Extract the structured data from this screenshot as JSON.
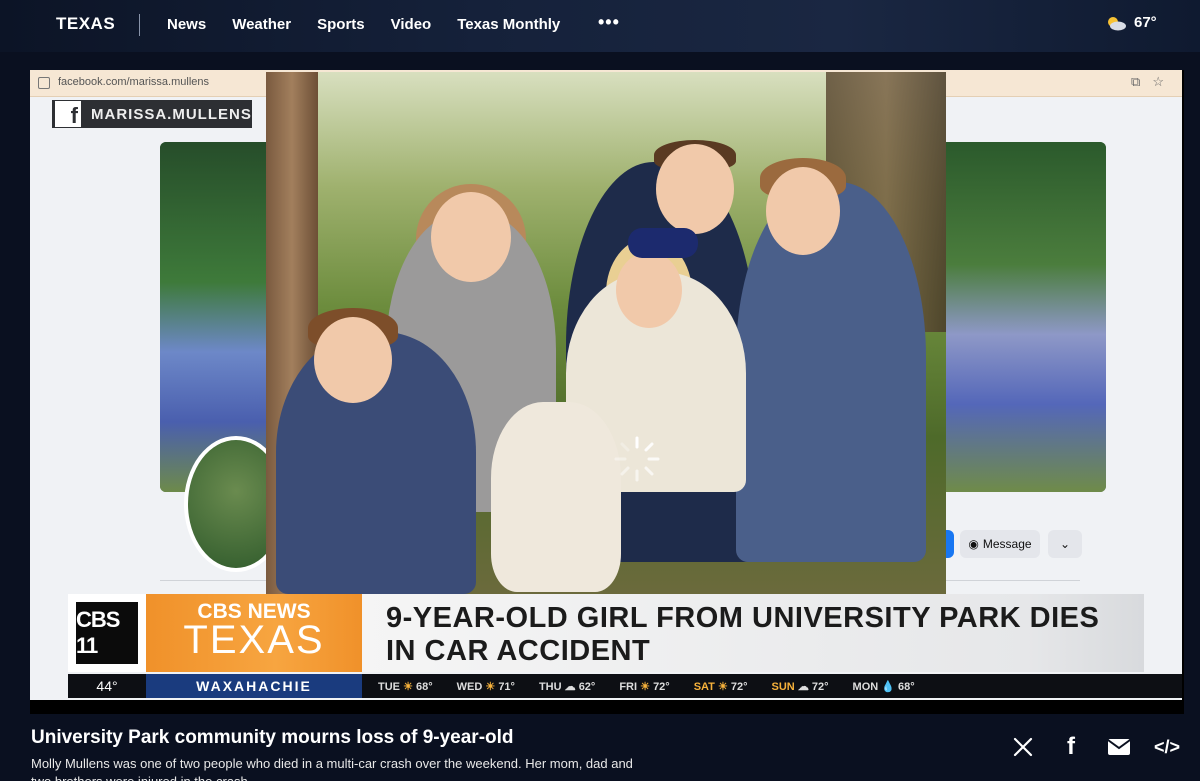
{
  "nav": {
    "brand": "TEXAS",
    "items": [
      "News",
      "Weather",
      "Sports",
      "Video",
      "Texas Monthly"
    ],
    "more": "•••",
    "weather_temp": "67°"
  },
  "player": {
    "browser_url": "facebook.com/marissa.mullens",
    "fb_tag": "MARISSA.MULLENS",
    "fb_message_button": "Message",
    "lower_third": {
      "station_logo": "CBS 11",
      "network_line1": "CBS NEWS",
      "network_line2": "TEXAS",
      "headline": "9-YEAR-OLD GIRL FROM UNIVERSITY PARK DIES IN CAR ACCIDENT"
    },
    "ticker": {
      "temp": "44°",
      "city": "WAXAHACHIE",
      "forecast": [
        {
          "day": "TUE",
          "temp": "68°"
        },
        {
          "day": "WED",
          "temp": "71°"
        },
        {
          "day": "THU",
          "temp": "62°"
        },
        {
          "day": "FRI",
          "temp": "72°"
        },
        {
          "day": "SAT",
          "temp": "72°"
        },
        {
          "day": "SUN",
          "temp": "72°"
        },
        {
          "day": "MON",
          "temp": "68°"
        }
      ]
    }
  },
  "article": {
    "title": "University Park community mourns loss of 9-year-old",
    "summary": "Molly Mullens was one of two people who died in a multi-car crash over the weekend. Her mom, dad and two brothers were injured in the crash."
  },
  "share": {
    "icons": [
      "x-icon",
      "facebook-icon",
      "email-icon",
      "embed-icon"
    ]
  }
}
